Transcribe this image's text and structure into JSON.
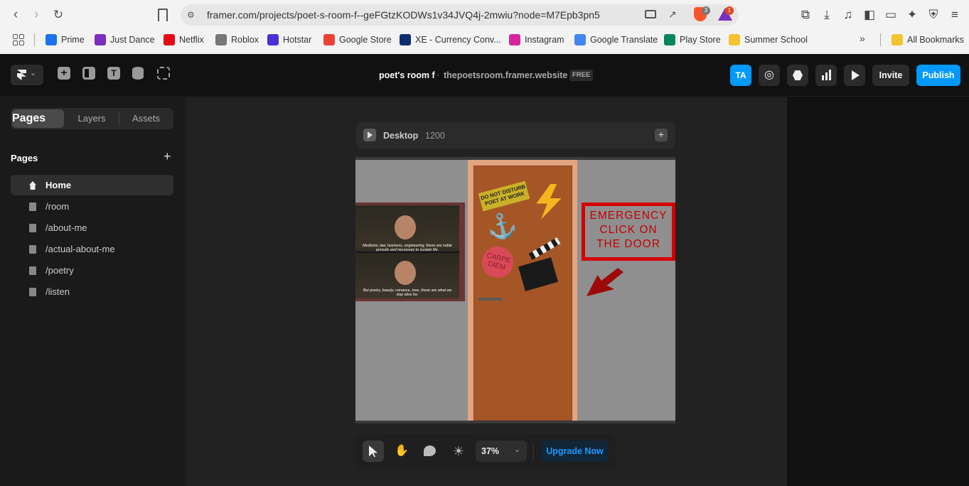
{
  "browser": {
    "url": "framer.com/projects/poet-s-room-f--geFGtzKODWs1v34JVQ4j-2mwiu?node=M7Epb3pn5",
    "brave_badge": "3",
    "alert_badge": "1",
    "bookmarks": [
      {
        "label": "Prime",
        "icon": "prime-icon",
        "color": "#1a73e8"
      },
      {
        "label": "Just Dance",
        "icon": "just-dance-icon",
        "color": "#7b2fbe"
      },
      {
        "label": "Netflix",
        "icon": "netflix-icon",
        "color": "#e50914"
      },
      {
        "label": "Roblox",
        "icon": "roblox-icon",
        "color": "#777777"
      },
      {
        "label": "Hotstar",
        "icon": "hotstar-icon",
        "color": "#4b2fd6"
      },
      {
        "label": "Google Store",
        "icon": "google-store-icon",
        "color": "#ea4335"
      },
      {
        "label": "XE - Currency Conv...",
        "icon": "xe-icon",
        "color": "#0b2e6f"
      },
      {
        "label": "Instagram",
        "icon": "instagram-icon",
        "color": "#d6249f"
      },
      {
        "label": "Google Translate",
        "icon": "translate-icon",
        "color": "#4285f4"
      },
      {
        "label": "Play Store",
        "icon": "play-store-icon",
        "color": "#01875f"
      },
      {
        "label": "Summer School",
        "icon": "folder-icon",
        "color": "#f4c430"
      }
    ],
    "all_bookmarks": "All Bookmarks"
  },
  "framer": {
    "project_name": "poet's room f",
    "separator": "·",
    "domain": "thepoetsroom.framer.website",
    "plan_badge": "FREE",
    "avatar_initials": "TA",
    "invite_label": "Invite",
    "publish_label": "Publish",
    "accent": "#0099ff"
  },
  "sidebar": {
    "tabs": [
      "Pages",
      "Layers",
      "Assets"
    ],
    "section_title": "Pages",
    "add_symbol": "+",
    "pages": [
      "Home",
      "/room",
      "/about-me",
      "/actual-about-me",
      "/poetry",
      "/listen"
    ]
  },
  "frame": {
    "name": "Desktop",
    "width": "1200",
    "sticker_note": "DO NOT DISTURB POET AT WORK",
    "stamp": "CARPE DIEM",
    "emergency_sign": "EMERGENCY CLICK ON THE DOOR",
    "caption_top": "Medicine, law, business, engineering, these are noble pursuits and necessary to sustain life.",
    "caption_bottom": "But poetry, beauty, romance, love, these are what we stay alive for."
  },
  "toolbar": {
    "zoom": "37%",
    "upgrade_label": "Upgrade Now"
  }
}
